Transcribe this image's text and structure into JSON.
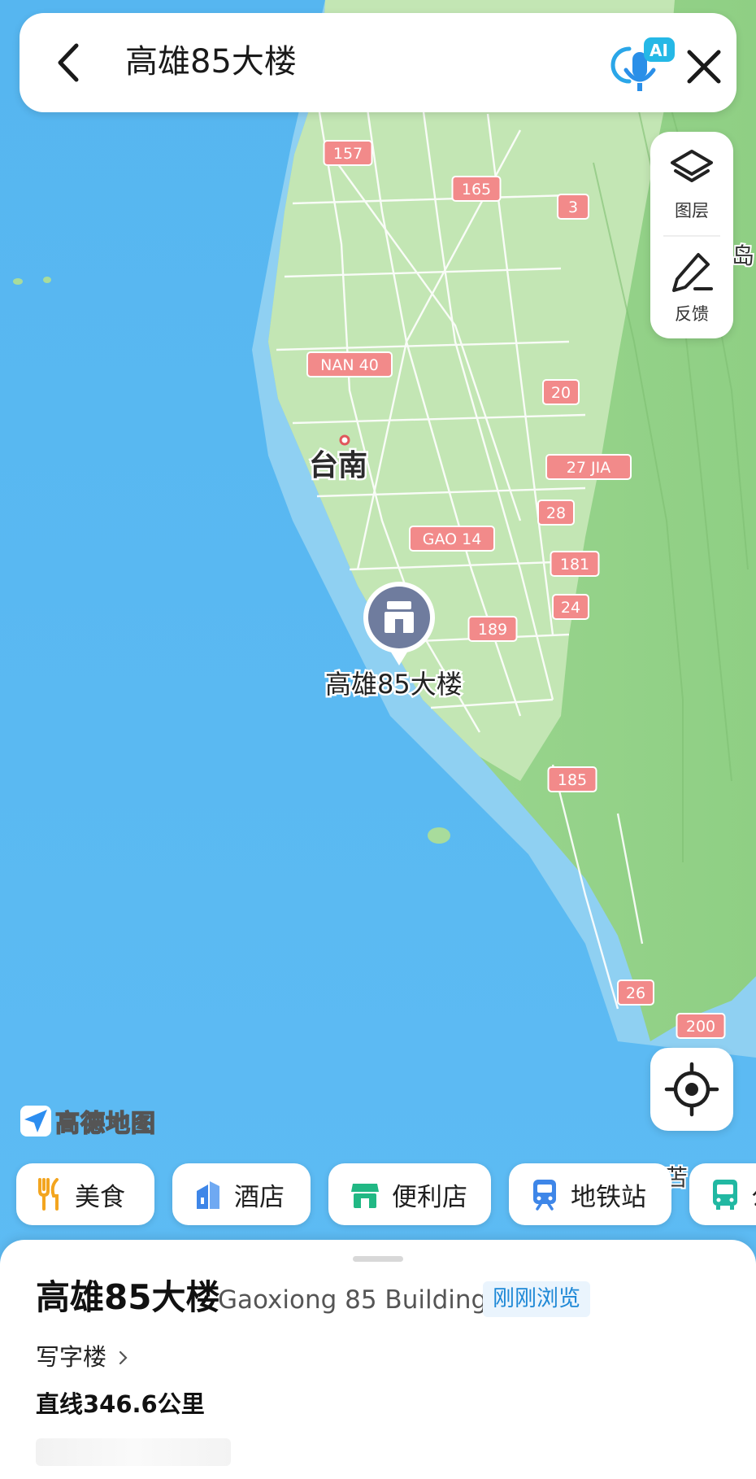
{
  "search": {
    "query": "高雄85大楼",
    "ai_badge": "AI"
  },
  "map_controls": {
    "layers_label": "图层",
    "feedback_label": "反馈"
  },
  "map": {
    "city_label": "台南",
    "poi_label": "高雄85大楼",
    "road_labels": [
      "157",
      "165",
      "3",
      "NAN 40",
      "20",
      "27 JIA",
      "28",
      "GAO 14",
      "181",
      "24",
      "189",
      "185",
      "26",
      "200"
    ],
    "edge_text_1": "岛",
    "edge_text_2": "苫",
    "logo_text": "高德地图",
    "colors": {
      "sea": "#53b7f2",
      "land": "#a8dc9c",
      "road_shield": "#f28a8a"
    }
  },
  "categories": [
    {
      "label": "美食",
      "icon": "food-icon"
    },
    {
      "label": "酒店",
      "icon": "hotel-icon"
    },
    {
      "label": "便利店",
      "icon": "store-icon"
    },
    {
      "label": "地铁站",
      "icon": "subway-icon"
    },
    {
      "label": "公",
      "icon": "bus-icon"
    }
  ],
  "place": {
    "name": "高雄85大楼",
    "name_en": "Gaoxiong 85 Building",
    "badge": "刚刚浏览",
    "type": "写字楼",
    "distance": "直线346.6公里"
  }
}
